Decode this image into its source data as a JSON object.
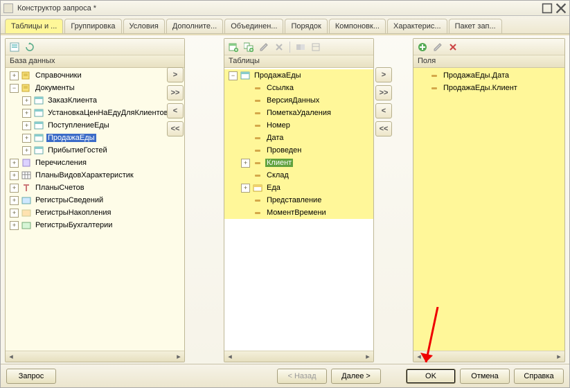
{
  "window": {
    "title": "Конструктор запроса *"
  },
  "tabs": [
    {
      "label": "Таблицы и ...",
      "active": true
    },
    {
      "label": "Группировка"
    },
    {
      "label": "Условия"
    },
    {
      "label": "Дополните..."
    },
    {
      "label": "Объединен..."
    },
    {
      "label": "Порядок"
    },
    {
      "label": "Компоновк..."
    },
    {
      "label": "Характерис..."
    },
    {
      "label": "Пакет зап..."
    }
  ],
  "panels": {
    "db": {
      "header": "База данных",
      "nodes": [
        {
          "exp": "+",
          "level": 0,
          "icon": "book",
          "label": "Справочники"
        },
        {
          "exp": "-",
          "level": 0,
          "icon": "book",
          "label": "Документы"
        },
        {
          "exp": "+",
          "level": 1,
          "icon": "table",
          "label": "ЗаказКлиента"
        },
        {
          "exp": "+",
          "level": 1,
          "icon": "table",
          "label": "УстановкаЦенНаЕдуДляКлиентов"
        },
        {
          "exp": "+",
          "level": 1,
          "icon": "table",
          "label": "ПоступлениеЕды"
        },
        {
          "exp": "+",
          "level": 1,
          "icon": "table",
          "label": "ПродажаЕды",
          "selected": true
        },
        {
          "exp": "+",
          "level": 1,
          "icon": "table",
          "label": "ПрибытиеГостей"
        },
        {
          "exp": "+",
          "level": 0,
          "icon": "enum",
          "label": "Перечисления"
        },
        {
          "exp": "+",
          "level": 0,
          "icon": "grid",
          "label": "ПланыВидовХарактеристик"
        },
        {
          "exp": "+",
          "level": 0,
          "icon": "tacc",
          "label": "ПланыСчетов"
        },
        {
          "exp": "+",
          "level": 0,
          "icon": "reg",
          "label": "РегистрыСведений"
        },
        {
          "exp": "+",
          "level": 0,
          "icon": "reg2",
          "label": "РегистрыНакопления"
        },
        {
          "exp": "+",
          "level": 0,
          "icon": "reg3",
          "label": "РегистрыБухгалтерии"
        }
      ]
    },
    "tables": {
      "header": "Таблицы",
      "nodes": [
        {
          "exp": "-",
          "level": 0,
          "icon": "table",
          "label": "ПродажаЕды",
          "hl": true
        },
        {
          "level": 1,
          "icon": "field",
          "label": "Ссылка",
          "hl": true
        },
        {
          "level": 1,
          "icon": "field",
          "label": "ВерсияДанных",
          "hl": true
        },
        {
          "level": 1,
          "icon": "field",
          "label": "ПометкаУдаления",
          "hl": true
        },
        {
          "level": 1,
          "icon": "field",
          "label": "Номер",
          "hl": true
        },
        {
          "level": 1,
          "icon": "field",
          "label": "Дата",
          "hl": true
        },
        {
          "level": 1,
          "icon": "field",
          "label": "Проведен",
          "hl": true
        },
        {
          "exp": "+",
          "level": 1,
          "icon": "field",
          "label": "Клиент",
          "hl": true,
          "fieldsel": true
        },
        {
          "level": 1,
          "icon": "field",
          "label": "Склад",
          "hl": true
        },
        {
          "exp": "+",
          "level": 1,
          "icon": "tbl2",
          "label": "Еда",
          "hl": true
        },
        {
          "level": 1,
          "icon": "field",
          "label": "Представление",
          "hl": true
        },
        {
          "level": 1,
          "icon": "field",
          "label": "МоментВремени",
          "hl": true
        }
      ]
    },
    "fields": {
      "header": "Поля",
      "nodes": [
        {
          "level": 0,
          "icon": "field",
          "label": "ПродажаЕды.Дата",
          "hl": true
        },
        {
          "level": 0,
          "icon": "field",
          "label": "ПродажаЕды.Клиент",
          "hl": true
        }
      ]
    }
  },
  "footer": {
    "query": "Запрос",
    "back": "< Назад",
    "next": "Далее >",
    "ok": "OK",
    "cancel": "Отмена",
    "help": "Справка"
  },
  "icons": {
    "plus": "+",
    "minus": "−"
  }
}
